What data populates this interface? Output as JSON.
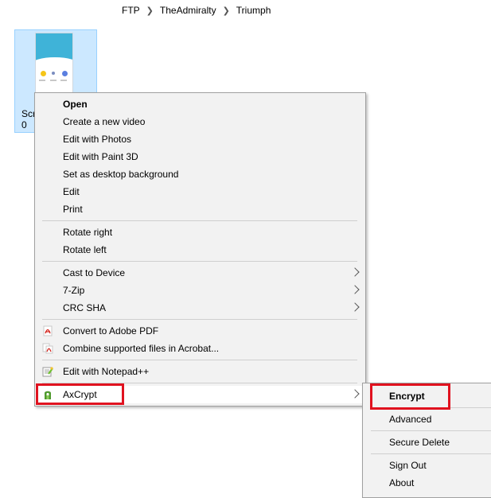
{
  "breadcrumb": [
    "FTP",
    "TheAdmiralty",
    "Triumph"
  ],
  "file": {
    "name": "Scr\n0"
  },
  "context_menu": {
    "open": "Open",
    "create_video": "Create a new video",
    "edit_photos": "Edit with Photos",
    "edit_paint3d": "Edit with Paint 3D",
    "set_background": "Set as desktop background",
    "edit": "Edit",
    "print": "Print",
    "rotate_right": "Rotate right",
    "rotate_left": "Rotate left",
    "cast_to_device": "Cast to Device",
    "seven_zip": "7-Zip",
    "crc_sha": "CRC SHA",
    "convert_pdf": "Convert to Adobe PDF",
    "combine_acrobat": "Combine supported files in Acrobat...",
    "edit_notepad": "Edit with Notepad++",
    "axcrypt": "AxCrypt"
  },
  "axcrypt_submenu": {
    "encrypt": "Encrypt",
    "advanced": "Advanced",
    "secure_delete": "Secure Delete",
    "sign_out": "Sign Out",
    "about": "About"
  },
  "colors": {
    "highlight": "#e0121f",
    "selection": "#cce8ff",
    "menu_bg": "#f2f2f2"
  }
}
